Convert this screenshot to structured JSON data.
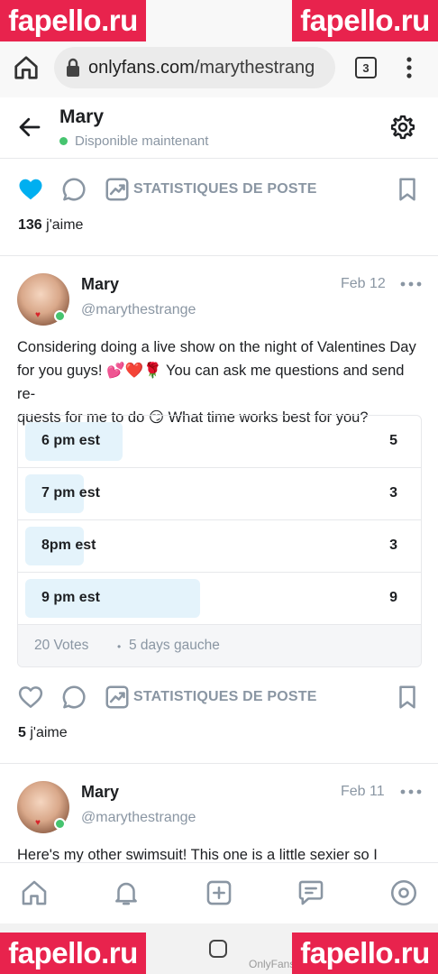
{
  "watermark": {
    "text": "fapello.ru",
    "color": "#e8234d"
  },
  "browser": {
    "url_host": "onlyfans.com",
    "url_path": "/marythestrang",
    "tab_count": "3",
    "icons": [
      "home-icon",
      "lock-icon",
      "tabs-icon",
      "more-vert-icon"
    ]
  },
  "header": {
    "name": "Mary",
    "status": "Disponible maintenant",
    "status_color": "#46c46f"
  },
  "post_prev": {
    "stats_label": "STATISTIQUES DE POSTE",
    "likes_count": "136",
    "likes_suffix": " j'aime",
    "liked": true,
    "like_color": "#00aff0"
  },
  "post1": {
    "name": "Mary",
    "handle": "@marythestrange",
    "date": "Feb 12",
    "text_lines": [
      "Considering doing a live show on the night of Valentines Day",
      "for you guys! 💕❤️🌹 You can ask me questions and send re-",
      "quests for me to do 😏 What time works best for you?"
    ],
    "poll": {
      "options": [
        {
          "label": "6 pm est",
          "votes": 5,
          "fill": 0.25
        },
        {
          "label": "7 pm est",
          "votes": 3,
          "fill": 0.15
        },
        {
          "label": "8pm est",
          "votes": 3,
          "fill": 0.15
        },
        {
          "label": "9 pm est",
          "votes": 9,
          "fill": 0.45
        }
      ],
      "votes_total": "20 Votes",
      "separator": "•",
      "time_left": "5 days gauche"
    },
    "stats_label": "STATISTIQUES DE POSTE",
    "likes_count": "5",
    "likes_suffix": " j'aime"
  },
  "post2": {
    "name": "Mary",
    "handle": "@marythestrange",
    "date": "Feb 11",
    "text": "Here's my other swimsuit! This one is a little sexier so I"
  },
  "bottom_nav": [
    "home-icon",
    "bell-icon",
    "add-post-icon",
    "messages-icon",
    "profile-icon"
  ],
  "system": {
    "caption": "OnlyFans"
  }
}
